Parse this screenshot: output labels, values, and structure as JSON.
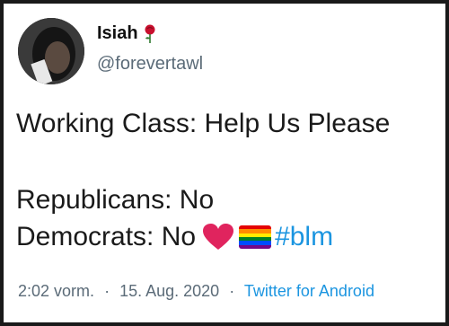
{
  "tweet": {
    "author_name": "Isiah",
    "author_handle": "@forevertawl",
    "lines": [
      "Working Class: Help Us Please",
      "Republicans: No",
      "Democrats: No"
    ],
    "hashtag": "#blm",
    "time": "2:02 vorm.",
    "date": "15. Aug. 2020",
    "separator": "·",
    "source": "Twitter for Android"
  },
  "icons": {
    "name_badge": "rose-icon",
    "emoji_1": "red-heart-icon",
    "emoji_2": "rainbow-flag-icon"
  },
  "colors": {
    "link": "#1b95e0",
    "secondary_text": "#5b6b78",
    "heart": "#e0245e"
  }
}
